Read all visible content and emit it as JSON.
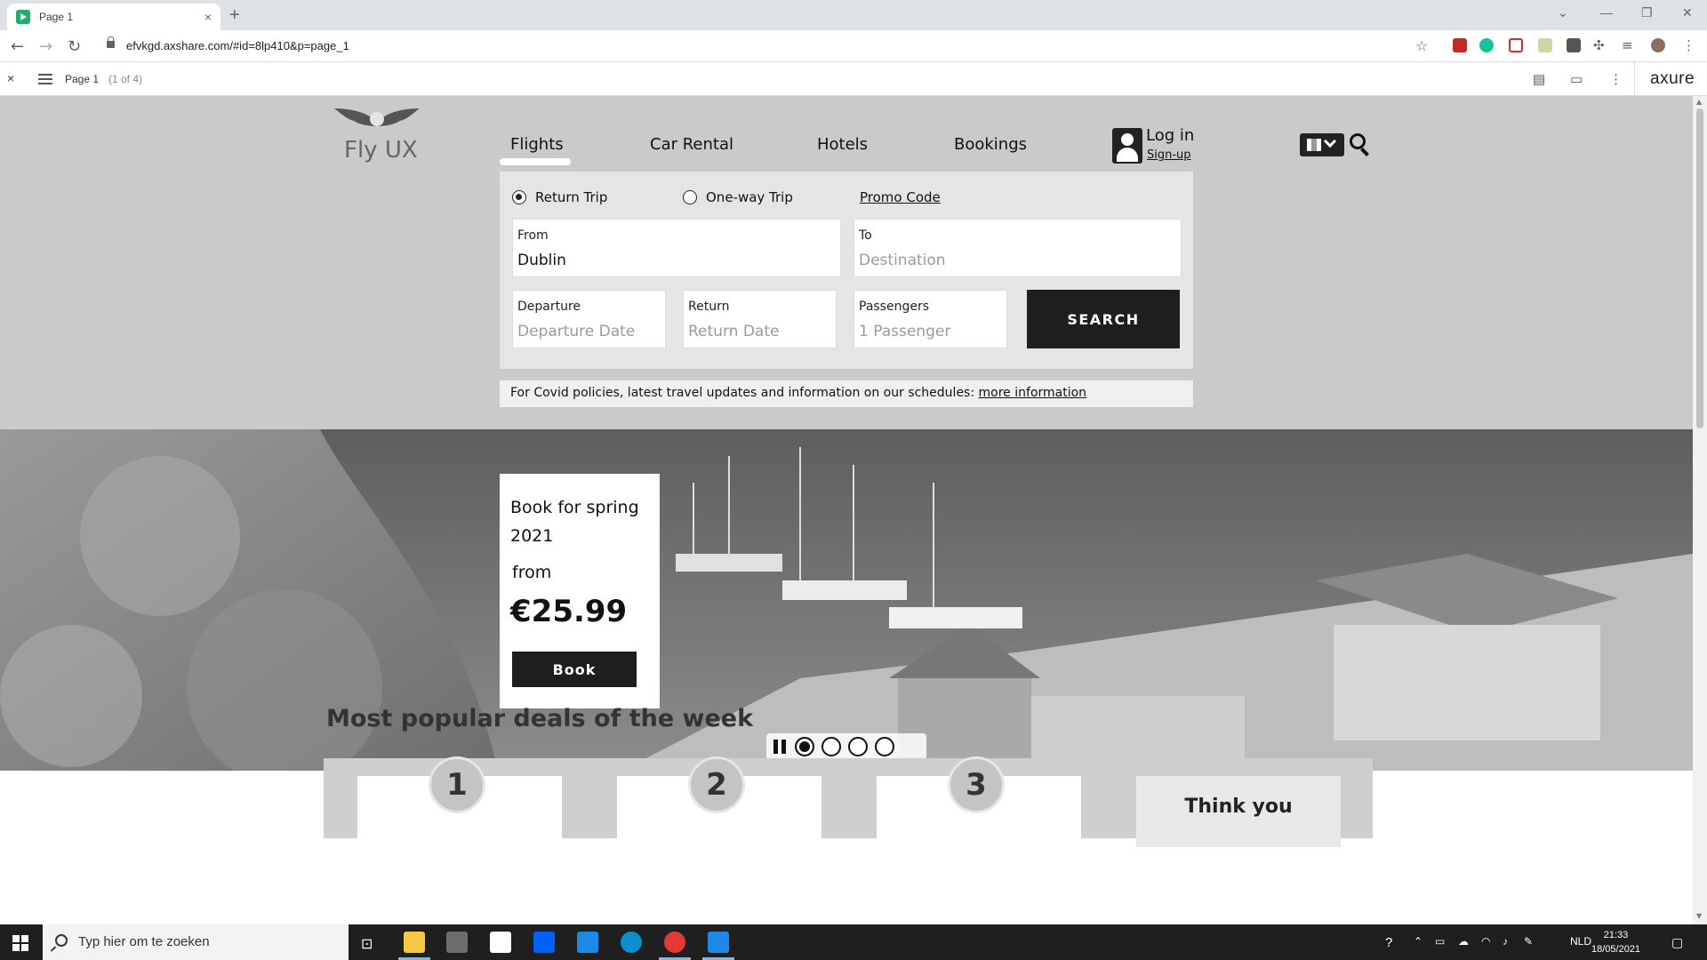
{
  "browser": {
    "tab_title": "Page 1",
    "tab_close": "×",
    "new_tab": "+",
    "url": "efvkgd.axshare.com/#id=8lp410&p=page_1"
  },
  "axure": {
    "close": "×",
    "page_label": "Page 1",
    "page_count": "(1 of 4)",
    "logo": "axure"
  },
  "site": {
    "brand": "Fly UX",
    "nav": [
      "Flights",
      "Car Rental",
      "Hotels",
      "Bookings"
    ],
    "login": "Log in",
    "signup": "Sign-up"
  },
  "booking": {
    "trip_types": [
      "Return Trip",
      "One-way Trip"
    ],
    "selected_trip": "Return Trip",
    "promo": "Promo Code",
    "from": {
      "label": "From",
      "value": "Dublin"
    },
    "to": {
      "label": "To",
      "placeholder": "Destination"
    },
    "departure": {
      "label": "Departure",
      "placeholder": "Departure Date"
    },
    "return": {
      "label": "Return",
      "placeholder": "Return Date"
    },
    "passengers": {
      "label": "Passengers",
      "placeholder": "1 Passenger"
    },
    "search": "SEARCH"
  },
  "covid": {
    "text": "For Covid policies, latest travel updates and information on our schedules: ",
    "link": "more information"
  },
  "hero": {
    "card_title": "Book for spring 2021",
    "card_from": "from",
    "card_price": "€25.99",
    "card_button": "Book",
    "slide_count": 4,
    "active_slide": 1
  },
  "deals": {
    "title": "Most popular deals of the week",
    "numbers": [
      "1",
      "2",
      "3"
    ],
    "last_card": "Think you"
  },
  "taskbar": {
    "search_text": "Typ hier om te zoeken",
    "language": "NLD",
    "time": "21:33",
    "date": "18/05/2021"
  }
}
